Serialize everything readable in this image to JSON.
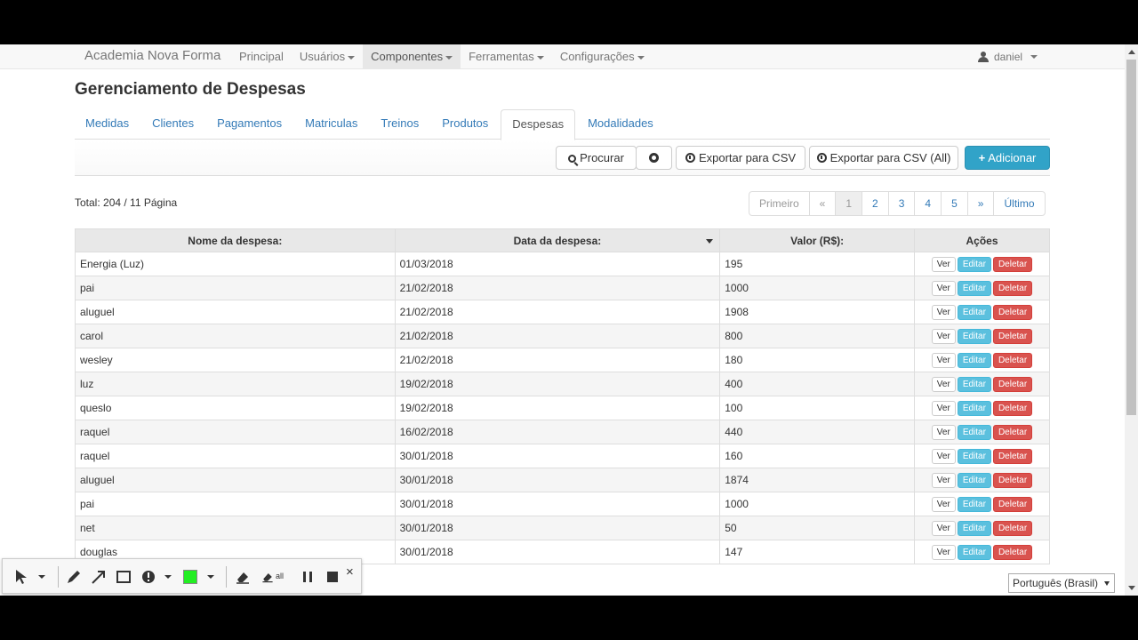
{
  "navbar": {
    "brand": "Academia Nova Forma",
    "items": [
      {
        "label": "Principal",
        "caret": false,
        "active": false
      },
      {
        "label": "Usuários",
        "caret": true,
        "active": false
      },
      {
        "label": "Componentes",
        "caret": true,
        "active": true
      },
      {
        "label": "Ferramentas",
        "caret": true,
        "active": false
      },
      {
        "label": "Configurações",
        "caret": true,
        "active": false
      }
    ],
    "user": "daniel"
  },
  "page": {
    "title": "Gerenciamento de Despesas"
  },
  "tabs": [
    "Medidas",
    "Clientes",
    "Pagamentos",
    "Matriculas",
    "Treinos",
    "Produtos",
    "Despesas",
    "Modalidades"
  ],
  "active_tab": "Despesas",
  "toolbar": {
    "search_label": "Procurar",
    "export_csv_label": "Exportar para CSV",
    "export_csv_all_label": "Exportar para CSV (All)",
    "add_label": "Adicionar"
  },
  "summary": {
    "total": "Total: 204 / 11 Página"
  },
  "pagination": {
    "first": "Primeiro",
    "prev": "«",
    "pages": [
      "1",
      "2",
      "3",
      "4",
      "5"
    ],
    "current": "1",
    "next": "»",
    "last": "Último"
  },
  "table": {
    "headers": [
      "Nome da despesa:",
      "Data da despesa:",
      "Valor (R$):",
      "Ações"
    ],
    "action_labels": {
      "view": "Ver",
      "edit": "Editar",
      "delete": "Deletar"
    },
    "rows": [
      {
        "nome": "Energia (Luz)",
        "data": "01/03/2018",
        "valor": "195"
      },
      {
        "nome": "pai",
        "data": "21/02/2018",
        "valor": "1000"
      },
      {
        "nome": "aluguel",
        "data": "21/02/2018",
        "valor": "1908"
      },
      {
        "nome": "carol",
        "data": "21/02/2018",
        "valor": "800"
      },
      {
        "nome": "wesley",
        "data": "21/02/2018",
        "valor": "180"
      },
      {
        "nome": "luz",
        "data": "19/02/2018",
        "valor": "400"
      },
      {
        "nome": "queslo",
        "data": "19/02/2018",
        "valor": "100"
      },
      {
        "nome": "raquel",
        "data": "16/02/2018",
        "valor": "440"
      },
      {
        "nome": "raquel",
        "data": "30/01/2018",
        "valor": "160"
      },
      {
        "nome": "aluguel",
        "data": "30/01/2018",
        "valor": "1874"
      },
      {
        "nome": "pai",
        "data": "30/01/2018",
        "valor": "1000"
      },
      {
        "nome": "net",
        "data": "30/01/2018",
        "valor": "50"
      },
      {
        "nome": "douglas",
        "data": "30/01/2018",
        "valor": "147"
      }
    ]
  },
  "recording_toolbar": {
    "tools": [
      "pointer-icon",
      "pencil-icon",
      "arrow-icon",
      "rectangle-icon",
      "highlight-icon",
      "color-swatch",
      "eraser-icon",
      "erase-all-icon",
      "pause-icon",
      "stop-icon",
      "close-icon"
    ],
    "color": "#22ee22",
    "erase_all_label": "all",
    "close_label": "×"
  },
  "language": {
    "selected": "Português (Brasil)"
  },
  "colors": {
    "link": "#337ab7",
    "primary": "#31a3c8",
    "edit": "#5bc0de",
    "delete": "#d9534f"
  }
}
